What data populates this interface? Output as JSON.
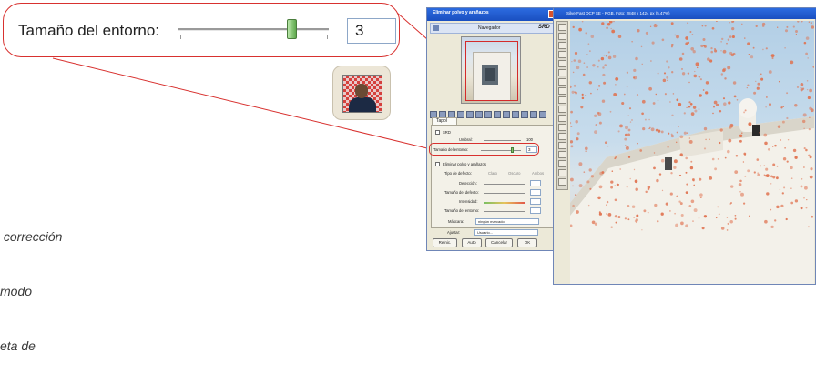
{
  "callout": {
    "label": "Tamaño del entorno:",
    "value": "3",
    "slider_level": 0.75
  },
  "caption": {
    "lines": [
      " corrección",
      "modo",
      "eta de"
    ]
  },
  "dialog": {
    "title": "Eliminar polvo y arañazos",
    "navigator_label": "Navegador",
    "logo": "SRD",
    "tab_label": "Tapol",
    "srd_checkbox_label": "SRD",
    "cutoff_label": "Umbral:",
    "cutoff_value": "100",
    "environment_label": "Tamaño del entorno:",
    "environment_value": "3",
    "dust_checkbox_label": "Eliminar polvo y arañazos",
    "defect_type_label": "Tipo de defecto:",
    "defect_options": [
      "Claro",
      "Oscuro",
      "Ambos"
    ],
    "detection_label": "Detección:",
    "defect_size_label": "Tamaño del defecto:",
    "intensity_label": "Intensidad:",
    "env_size_label": "Tamaño del entorno:",
    "mask_label": "Máscara:",
    "mask_value": "ningún marcado",
    "adjust_label": "Ajustar:",
    "adjust_value": "Usuario...",
    "buttons": {
      "reset": "Reinic.",
      "auto": "Auto",
      "cancel": "Cancelar",
      "ok": "OK"
    }
  },
  "photo": {
    "title": "SilverFast DCP SE - RGB, Foto: 2848 x 1424 px (5,47%)",
    "colors": {
      "speck": "#e0714e",
      "sky": "#c7dcec",
      "wall": "#f3f1ea"
    }
  }
}
